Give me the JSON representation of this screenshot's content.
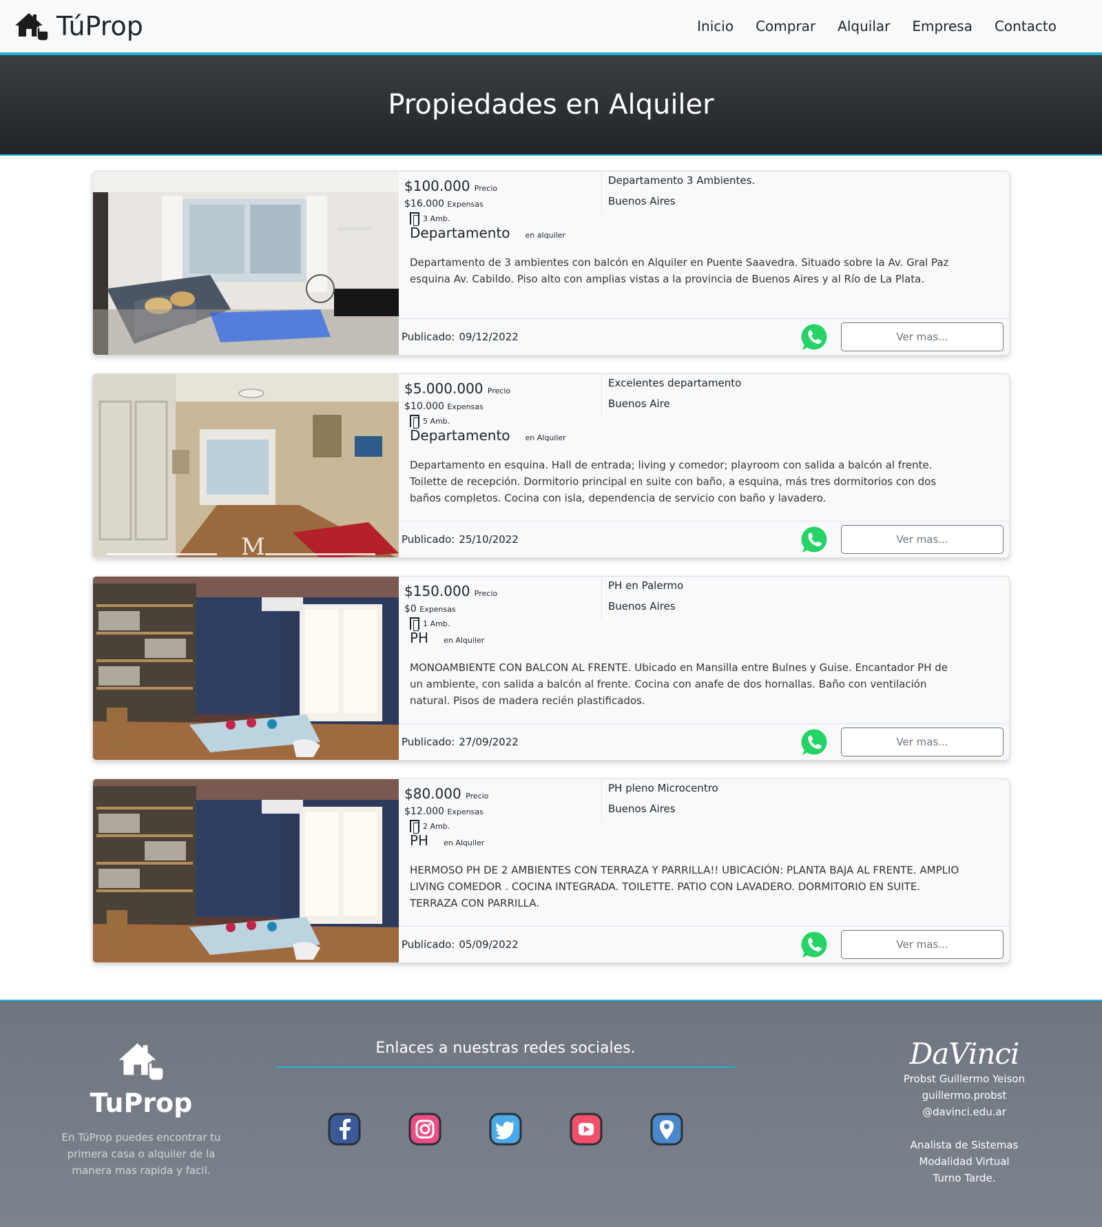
{
  "brand": {
    "name": "TúProp"
  },
  "nav": {
    "items": [
      "Inicio",
      "Comprar",
      "Alquilar",
      "Empresa",
      "Contacto"
    ]
  },
  "hero": {
    "title": "Propiedades en Alquiler"
  },
  "colors": {
    "accent": "#1eb3da",
    "navbar_bg": "#f8f9fa",
    "hero_bg": "#212529",
    "footer_bg": "#767d86",
    "whatsapp": "#25d366"
  },
  "labels": {
    "price": "Precio",
    "expensas": "Expensas",
    "published": "Publicado:",
    "ver_mas": "Ver mas..."
  },
  "listings": [
    {
      "price": "$100.000",
      "expensas": "$16.000",
      "ambientes": "3 Amb.",
      "tipo": "Departamento",
      "operacion": "en alquiler",
      "title": "Departamento 3 Ambientes.",
      "location": "Buenos Aires",
      "description": "Departamento de 3 ambientes con balcón en Alquiler en Puente Saavedra. Situado sobre la Av. Gral Paz esquina Av. Cabildo. Piso alto con amplias vistas a la provincia de Buenos Aires y al Río de La Plata.",
      "published": "09/12/2022"
    },
    {
      "price": "$5.000.000",
      "expensas": "$10.000",
      "ambientes": "5 Amb.",
      "tipo": "Departamento",
      "operacion": "en Alquiler",
      "title": "Excelentes departamento",
      "location": "Buenos Aire",
      "description": "Departamento en esquina. Hall de entrada; living y comedor; playroom con salida a balcón al frente. Toilette de recepción. Dormitorio principal en suite con baño, a esquina, más tres dormitorios con dos baños completos. Cocina con isla, dependencia de servicio con baño y lavadero.",
      "published": "25/10/2022"
    },
    {
      "price": "$150.000",
      "expensas": "$0",
      "ambientes": "1 Amb.",
      "tipo": "PH",
      "operacion": "en Alquiler",
      "title": "PH en Palermo",
      "location": "Buenos Aires",
      "description": "MONOAMBIENTE CON BALCON AL FRENTE. Ubicado en Mansilla entre Bulnes y Guise. Encantador PH de un ambiente, con salida a balcón al frente. Cocina con anafe de dos hornallas. Baño con ventilación natural. Pisos de madera recién plastificados.",
      "published": "27/09/2022"
    },
    {
      "price": "$80.000",
      "expensas": "$12.000",
      "ambientes": "2 Amb.",
      "tipo": "PH",
      "operacion": "en Alquiler",
      "title": "PH pleno Microcentro",
      "location": "Buenos Aires",
      "description": "HERMOSO PH DE 2 AMBIENTES CON TERRAZA Y PARRILLA!! UBICACIÓN: PLANTA BAJA AL FRENTE. AMPLIO LIVING COMEDOR . COCINA INTEGRADA. TOILETTE. PATIO CON LAVADERO. DORMITORIO EN SUITE. TERRAZA CON PARRILLA.",
      "published": "05/09/2022"
    }
  ],
  "footer": {
    "brand": "TuProp",
    "description": "En TúProp puedes encontrar tu primera casa o alquiler de la manera mas rapida y facil.",
    "social_title": "Enlaces a nuestras redes sociales.",
    "socials": [
      "facebook-icon",
      "instagram-icon",
      "twitter-icon",
      "youtube-icon",
      "location-icon"
    ],
    "davinci": "DaVinci",
    "author": "Probst Guillermo Yeison",
    "email": "guillermo.probst @davinci.edu.ar",
    "career": "Analista de Sistemas",
    "modality": "Modalidad Virtual",
    "shift": "Turno Tarde."
  }
}
